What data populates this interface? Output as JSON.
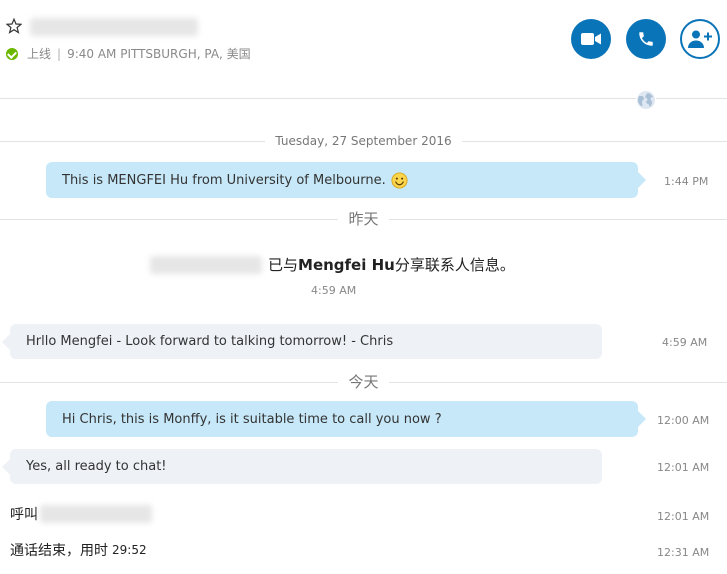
{
  "header": {
    "status": "上线",
    "separator": "|",
    "local_time": "9:40 AM PITTSBURGH, PA, 美国"
  },
  "dates": {
    "first": "Tuesday, 27 September 2016",
    "yesterday": "昨天",
    "today": "今天"
  },
  "messages": {
    "m1_text": "This is MENGFEI Hu from University of Melbourne.",
    "m1_time": "1:44 PM",
    "share_prefix": "已与",
    "share_name": "Mengfei Hu",
    "share_suffix": "分享联系人信息。",
    "share_time": "4:59 AM",
    "m2_text": "Hrllo Mengfei - Look forward to talking tomorrow! - Chris",
    "m2_time": "4:59 AM",
    "m3_text": "Hi Chris, this is Monffy, is it suitable time to call you now ?",
    "m3_time": "12:00 AM",
    "m4_text": "Yes, all ready to chat!",
    "m4_time": "12:01 AM",
    "call_text": "呼叫",
    "call_time": "12:01 AM",
    "end_text": "通话结束，用时",
    "end_duration": "29:52",
    "end_time": "12:31 AM"
  },
  "colors": {
    "accent": "#0a74b8",
    "outgoing_bubble": "#c7e8f8",
    "incoming_bubble": "#eef2f7",
    "online": "#6bb700"
  },
  "icons": {
    "favorite": "star-outline-icon",
    "video": "video-camera-icon",
    "call": "phone-icon",
    "add": "add-person-icon",
    "globe": "globe-icon",
    "emoji": "smiley-icon"
  }
}
